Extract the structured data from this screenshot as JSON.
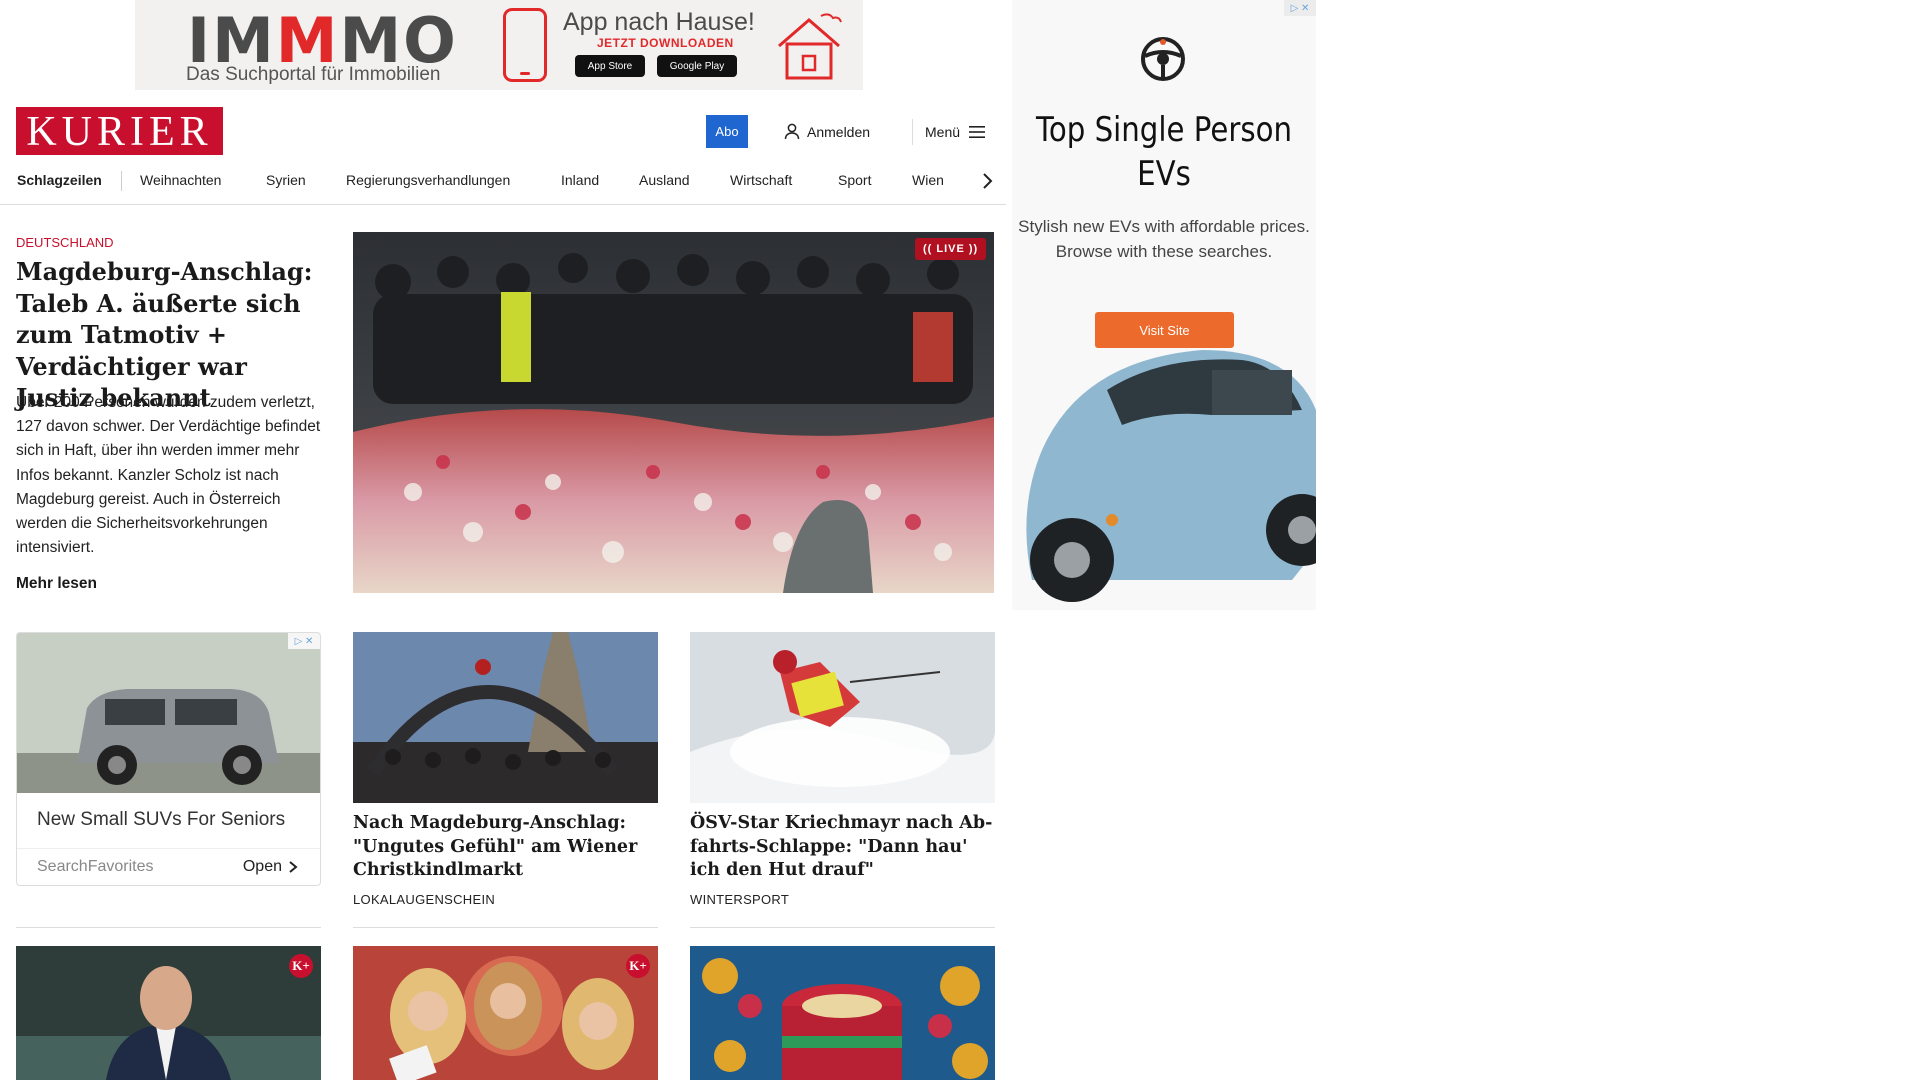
{
  "top_ad": {
    "brand_prefix": "IM",
    "brand_mm": "M",
    "brand_suffix": "MO",
    "tagline": "Das Suchportal für Immobilien",
    "app_title": "App nach Hause!",
    "app_cta": "JETZT DOWNLOADEN",
    "store_apple": "App Store",
    "store_google": "Google Play",
    "colors": {
      "brand_red": "#e2292a",
      "text_grey": "#4b4b4b"
    }
  },
  "header": {
    "logo": "KURIER",
    "abo_label": "Abo",
    "login_label": "Anmelden",
    "menu_label": "Menü",
    "icons": {
      "login": "user-icon",
      "menu": "hamburger-icon"
    },
    "colors": {
      "logo_red": "#c8102e",
      "abo_blue": "#2066d1"
    }
  },
  "nav": {
    "items": [
      "Schlagzeilen",
      "Weihnachten",
      "Syrien",
      "Regierungsverhandlungen",
      "Inland",
      "Ausland",
      "Wirtschaft",
      "Sport",
      "Wien"
    ],
    "next_icon": "chevron-right-icon"
  },
  "lead": {
    "kicker": "DEUTSCHLAND",
    "title": "Magdeburg-Anschlag: Taleb A. äußerte sich zum Tatmotiv + Verdächtiger war Justiz bekannt",
    "text": "Über 200 Personen wurden zudem verletzt, 127 davon schwer. Der Verdächtige befindet sich in Haft, über ihn werden immer mehr Infos bekannt. Kanzler Scholz ist nach Magdeburg gereist. Auch in Österreich werden die Sicherheitsvorkehrungen intensiviert.",
    "more": "Mehr lesen",
    "live_badge": "(( LIVE ))"
  },
  "ad_card": {
    "title": "New Small SUVs For Seniors",
    "source": "SearchFavorites",
    "open": "Open"
  },
  "teasers": [
    {
      "title": "Nach Magdeburg-Anschlag: \"Un­gutes Gefühl\" am Wiener Christkindlmarkt",
      "kicker": "LOKALAUGENSCHEIN"
    },
    {
      "title": "ÖSV-Star Kriechmayr nach Ab­fahrts-Schlappe: \"Dann hau' ich den Hut drauf\"",
      "kicker": "WINTERSPORT"
    }
  ],
  "premium_badge": "K+",
  "side_ad": {
    "headline": "Top Single Person EVs",
    "sub": "Stylish new EVs with affordable prices. Browse with these searches.",
    "cta": "Visit Site",
    "colors": {
      "cta": "#ec6a2c",
      "car": "#8fb8d0"
    }
  }
}
